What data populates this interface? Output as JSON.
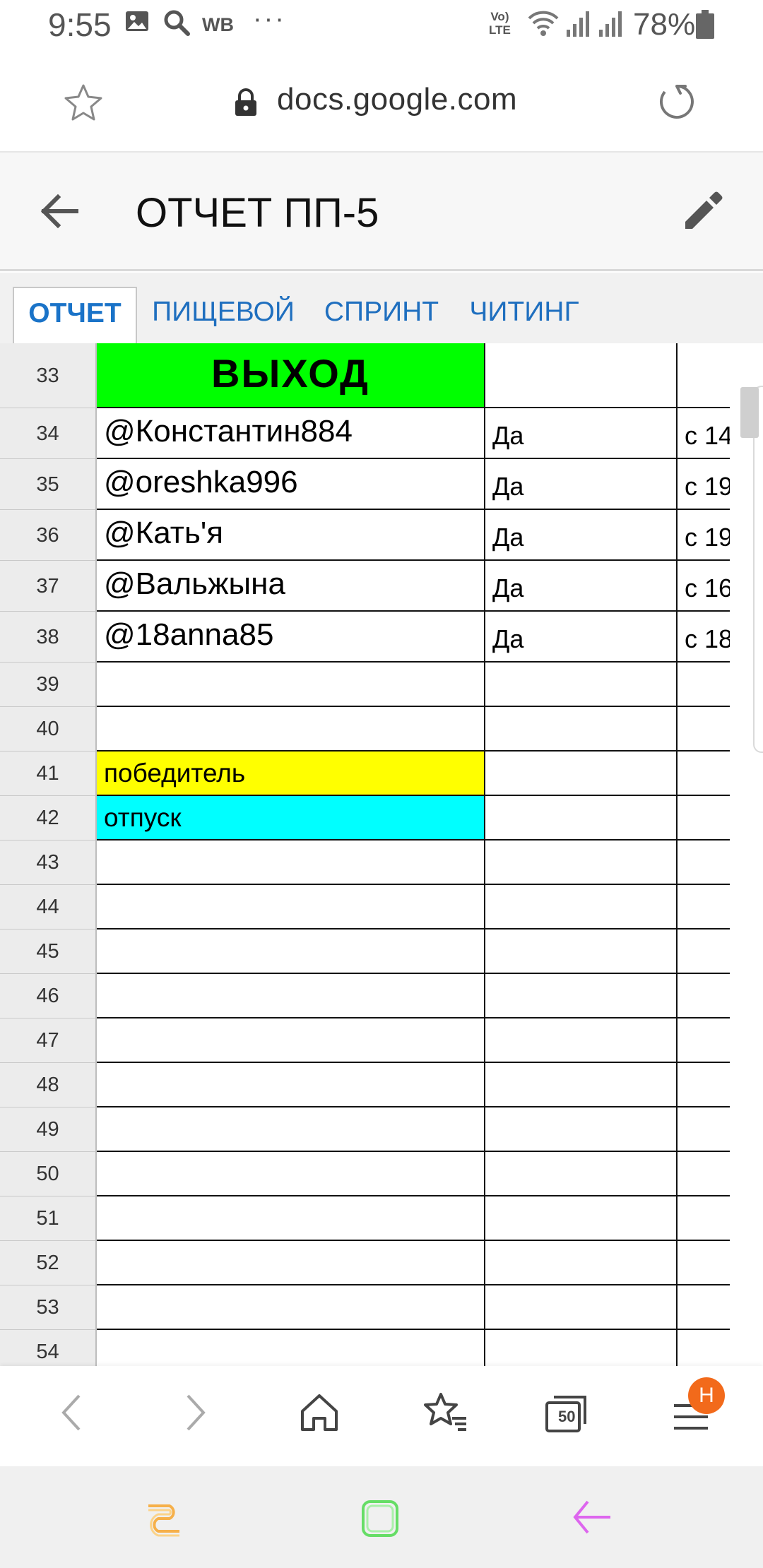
{
  "status_bar": {
    "time": "9:55",
    "carrier_label": "WB",
    "more": "···",
    "lte_top": "Vo)",
    "lte_bottom": "LTE",
    "battery": "78%"
  },
  "url_bar": {
    "url": "docs.google.com"
  },
  "doc": {
    "title": "ОТЧЕТ ПП-5"
  },
  "tabs": [
    {
      "label": "ОТЧЕТ",
      "active": true
    },
    {
      "label": "ПИЩЕВОЙ",
      "active": false
    },
    {
      "label": "СПРИНТ",
      "active": false
    },
    {
      "label": "ЧИТИНГ",
      "active": false
    }
  ],
  "rows": [
    {
      "num": "33",
      "a": "ВЫХОД",
      "b": "",
      "c": "",
      "fill": "#00ff00",
      "style": "header"
    },
    {
      "num": "34",
      "a": "@Константин884",
      "b": "Да",
      "c": "с 14",
      "fill": "",
      "style": "name"
    },
    {
      "num": "35",
      "a": "@oreshka996",
      "b": "Да",
      "c": "с 19",
      "fill": "",
      "style": "name"
    },
    {
      "num": "36",
      "a": "@Кать'я",
      "b": "Да",
      "c": "с 19",
      "fill": "",
      "style": "name"
    },
    {
      "num": "37",
      "a": "@Вальжына",
      "b": "Да",
      "c": "с 16",
      "fill": "",
      "style": "name"
    },
    {
      "num": "38",
      "a": "@18anna85",
      "b": "Да",
      "c": "с 18",
      "fill": "",
      "style": "name"
    },
    {
      "num": "39",
      "a": "",
      "b": "",
      "c": "",
      "fill": "",
      "style": "plain"
    },
    {
      "num": "40",
      "a": "",
      "b": "",
      "c": "",
      "fill": "",
      "style": "plain"
    },
    {
      "num": "41",
      "a": "победитель",
      "b": "",
      "c": "",
      "fill": "#ffff00",
      "style": "plain"
    },
    {
      "num": "42",
      "a": "отпуск",
      "b": "",
      "c": "",
      "fill": "#00ffff",
      "style": "plain"
    },
    {
      "num": "43",
      "a": "",
      "b": "",
      "c": "",
      "fill": "",
      "style": "plain"
    },
    {
      "num": "44",
      "a": "",
      "b": "",
      "c": "",
      "fill": "",
      "style": "plain"
    },
    {
      "num": "45",
      "a": "",
      "b": "",
      "c": "",
      "fill": "",
      "style": "plain"
    },
    {
      "num": "46",
      "a": "",
      "b": "",
      "c": "",
      "fill": "",
      "style": "plain"
    },
    {
      "num": "47",
      "a": "",
      "b": "",
      "c": "",
      "fill": "",
      "style": "plain"
    },
    {
      "num": "48",
      "a": "",
      "b": "",
      "c": "",
      "fill": "",
      "style": "plain"
    },
    {
      "num": "49",
      "a": "",
      "b": "",
      "c": "",
      "fill": "",
      "style": "plain"
    },
    {
      "num": "50",
      "a": "",
      "b": "",
      "c": "",
      "fill": "",
      "style": "plain"
    },
    {
      "num": "51",
      "a": "",
      "b": "",
      "c": "",
      "fill": "",
      "style": "plain"
    },
    {
      "num": "52",
      "a": "",
      "b": "",
      "c": "",
      "fill": "",
      "style": "plain"
    },
    {
      "num": "53",
      "a": "",
      "b": "",
      "c": "",
      "fill": "",
      "style": "plain"
    },
    {
      "num": "54",
      "a": "",
      "b": "",
      "c": "",
      "fill": "",
      "style": "plain"
    }
  ],
  "browser_nav": {
    "tabs_count": "50",
    "menu_badge": "H"
  },
  "colors": {
    "accent": "#1a73c8",
    "badge": "#f26a1b",
    "exit_green": "#00ff00",
    "winner_yellow": "#ffff00",
    "vacation_cyan": "#00ffff"
  }
}
